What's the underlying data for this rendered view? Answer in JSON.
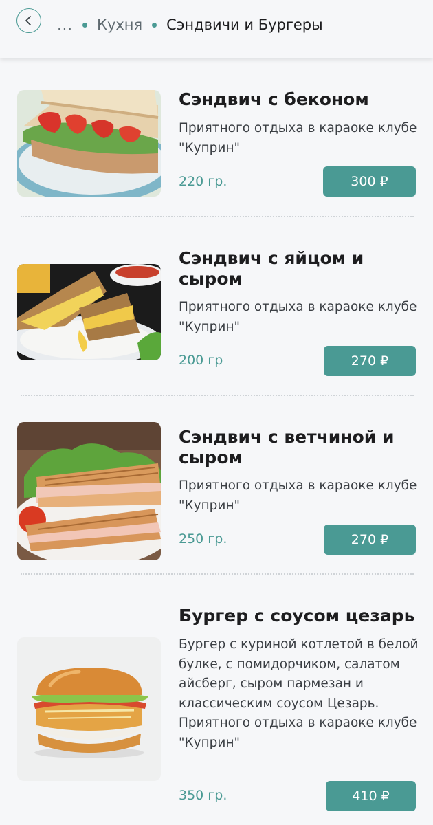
{
  "header": {
    "ellipsis": "...",
    "crumb_parent": "Кухня",
    "crumb_current": "Сэндвичи и Бургеры"
  },
  "items": [
    {
      "title": "Сэндвич с беконом",
      "description": [
        "Приятного отдыха в караоке клубе \"Куприн\""
      ],
      "weight": "220 гр.",
      "price": "300 ₽"
    },
    {
      "title": "Сэндвич с яйцом и сыром",
      "description": [
        "Приятного отдыха в караоке клубе \"Куприн\""
      ],
      "weight": "200 гр",
      "price": "270 ₽"
    },
    {
      "title": "Сэндвич с ветчиной и сыром",
      "description": [
        "Приятного отдыха в караоке клубе \"Куприн\""
      ],
      "weight": "250 гр.",
      "price": "270 ₽"
    },
    {
      "title": "Бургер с соусом цезарь",
      "description": [
        "Бургер с куриной котлетой в белой булке, с помидорчиком, салатом айсберг, сыром пармезан и классическим соусом Цезарь.",
        "Приятного отдыха в караоке клубе \"Куприн\""
      ],
      "weight": "350 гр.",
      "price": "410 ₽"
    }
  ],
  "colors": {
    "accent": "#4a9a94",
    "background": "#f6f7f9",
    "text": "#1d1d1f"
  },
  "icons": {
    "back": "chevron-left-icon"
  }
}
